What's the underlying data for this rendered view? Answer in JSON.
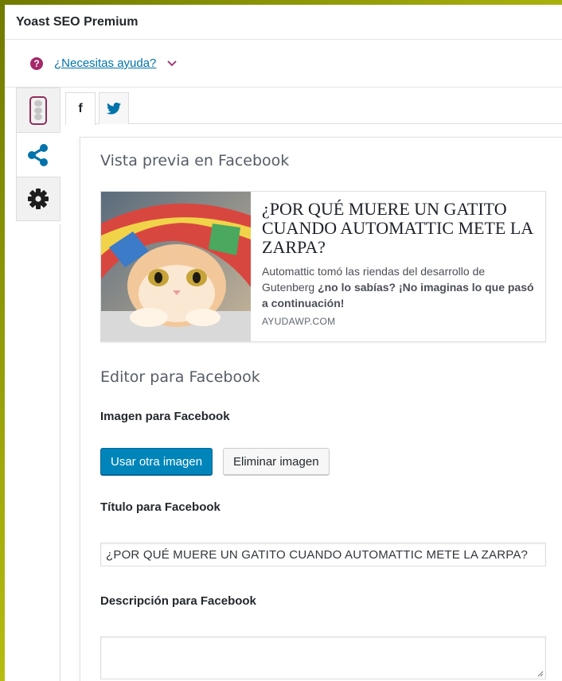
{
  "header": {
    "title": "Yoast SEO Premium"
  },
  "help": {
    "link": "¿Necesitas ayuda?",
    "icon": "question-circle-icon"
  },
  "colors": {
    "accent": "#a4286a",
    "primary": "#0085ba",
    "link": "#0073aa",
    "facebook": "#3b5998",
    "twitter": "#1da1f2"
  },
  "side_tabs": [
    {
      "name": "readability",
      "icon": "traffic-light-icon"
    },
    {
      "name": "social",
      "icon": "share-icon",
      "active": true
    },
    {
      "name": "settings",
      "icon": "gear-icon"
    }
  ],
  "social_tabs": [
    {
      "label": "f",
      "icon": "facebook-icon",
      "active": true
    },
    {
      "label": "",
      "icon": "twitter-icon"
    }
  ],
  "preview": {
    "heading": "Vista previa en Facebook",
    "title": "¿POR QUÉ MUERE UN GATITO CUANDO AUTOMATTIC METE LA ZARPA?",
    "desc_plain": "Automattic tomó las riendas del desarrollo de Gutenberg ",
    "desc_bold": "¿no lo sabías? ¡No imaginas lo que pasó a continuación!",
    "domain": "AYUDAWP.COM"
  },
  "editor": {
    "heading": "Editor para Facebook",
    "image_label": "Imagen para Facebook",
    "use_image_button": "Usar otra imagen",
    "remove_image_button": "Eliminar imagen",
    "title_label": "Título para Facebook",
    "title_value": "¿POR QUÉ MUERE UN GATITO CUANDO AUTOMATTIC METE LA ZARPA?",
    "description_label": "Descripción para Facebook",
    "description_value": ""
  }
}
